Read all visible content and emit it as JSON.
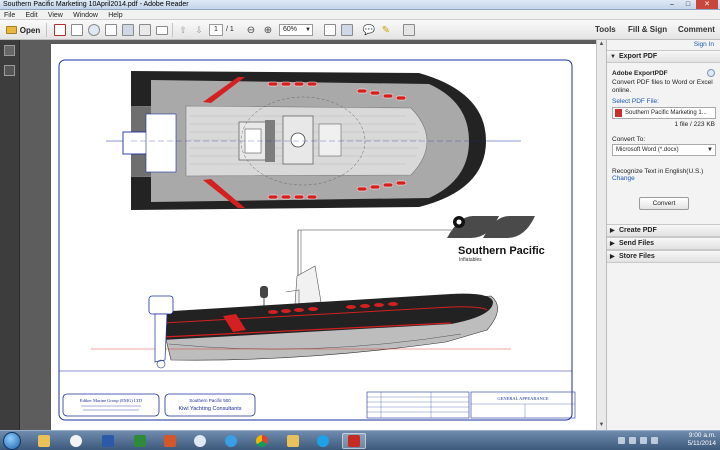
{
  "window": {
    "title": "Southern Pacific Marketing 10April2014.pdf - Adobe Reader"
  },
  "menu": [
    "File",
    "Edit",
    "View",
    "Window",
    "Help"
  ],
  "toolbar": {
    "open_label": "Open",
    "page_current": "1",
    "page_total": "/ 1",
    "zoom": "60%",
    "tools_label": "Tools",
    "fill_sign_label": "Fill & Sign",
    "comment_label": "Comment"
  },
  "pane": {
    "sign_in": "Sign In",
    "export_pdf": {
      "header": "Export PDF",
      "service_title": "Adobe ExportPDF",
      "description_1": "Convert PDF files to Word or Excel",
      "description_2": "online.",
      "select_file_label": "Select PDF File:",
      "file_name": "Southern Pacific Marketing 1...",
      "file_info": "1 file / 223 KB",
      "convert_to_label": "Convert To:",
      "convert_to_value": "Microsoft Word (*.docx)",
      "recognize_text": "Recognize Text in English(U.S.)",
      "change_link": "Change",
      "convert_button": "Convert"
    },
    "sections": [
      "Create PDF",
      "Send Files",
      "Store Files"
    ]
  },
  "document": {
    "brand_name": "Southern Pacific",
    "brand_sub": "Inflatables",
    "left_box_title": "Ediker Marine Group (EMG) LTD",
    "mid_box_line_1": "Southern Pacific 500",
    "mid_box_line_2": "Kiwi Yachting Consultants",
    "title_block": "GENERAL APPEARANCE"
  },
  "taskbar": {
    "time": "9:00 a.m.",
    "date": "5/11/2014"
  },
  "colors": {
    "hull_dark": "#222222",
    "hull_grey": "#a6a6a6",
    "accent_red": "#d42020",
    "drawing_blue": "#1a2f9b"
  }
}
